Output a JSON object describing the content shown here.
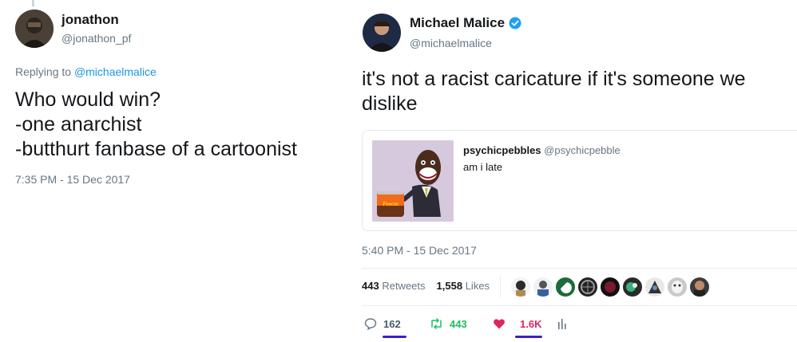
{
  "left_tweet": {
    "display_name": "jonathon",
    "handle": "@jonathon_pf",
    "replying_prefix": "Replying to",
    "replying_handle": "@michaelmalice",
    "text_lines": [
      "Who would win?",
      "-one anarchist",
      "-butthurt fanbase of a cartoonist"
    ],
    "timestamp": "7:35 PM - 15 Dec 2017"
  },
  "right_tweet": {
    "display_name": "Michael Malice",
    "handle": "@michaelmalice",
    "verified_icon": "verified-badge-icon",
    "text_lines": [
      "it's not a racist caricature if it's someone we",
      "dislike"
    ],
    "quoted": {
      "display_name": "psychicpebbles",
      "handle": "@psychicpebble",
      "text": "am i late",
      "image_label": "Feeces"
    },
    "timestamp": "5:40 PM - 15 Dec 2017",
    "retweets_count": "443",
    "retweets_label": "Retweets",
    "likes_count": "1,558",
    "likes_label": "Likes",
    "actions": {
      "replies": "162",
      "retweets": "443",
      "likes": "1.6K"
    },
    "colors": {
      "retweet": "#17bf63",
      "like": "#e0245e",
      "underline": "#3b1fd1"
    }
  }
}
